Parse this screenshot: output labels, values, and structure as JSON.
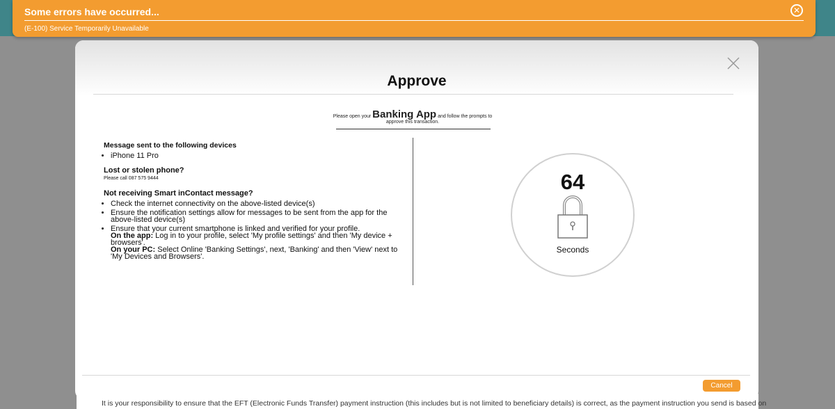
{
  "error_banner": {
    "title": "Some errors have occurred...",
    "message": "(E-100) Service Temporarily Unavailable",
    "close_icon": "circle-x-icon"
  },
  "modal": {
    "title": "Approve",
    "instruction": {
      "prefix": "Please open your",
      "app_name": "Banking App",
      "suffix": "and follow the prompts to approve this transaction."
    },
    "devices": {
      "heading": "Message sent to the following devices",
      "items": [
        "iPhone 11 Pro"
      ]
    },
    "lost_phone": {
      "heading": "Lost or stolen phone?",
      "text": "Please call 087 575 9444"
    },
    "not_receiving": {
      "heading": "Not receiving Smart inContact message?",
      "items": [
        "Check the internet connectivity on the above-listed device(s)",
        "Ensure the notification settings allow for messages to be sent from the app for the above-listed device(s)",
        "Ensure that your current smartphone is linked and verified for your profile."
      ],
      "app_label": "On the app:",
      "app_text": " Log in to your profile, select 'My profile settings' and then 'My device + browsers'.",
      "pc_label": "On your PC:",
      "pc_text": " Select Online 'Banking Settings', next, 'Banking' and then 'View' next to 'My Devices and Browsers'."
    },
    "timer": {
      "value": "64",
      "label": "Seconds",
      "icon": "lock-icon"
    },
    "cancel_label": "Cancel",
    "close_icon": "close-icon"
  },
  "footer_text": "It is your responsibility to ensure that the EFT (Electronic Funds Transfer) payment instruction (this includes but is not limited to beneficiary details) is correct, as the payment instruction you send is based on",
  "colors": {
    "accent": "#f39c30",
    "header_bg": "#3f8589",
    "overlay": "#8f8f8f"
  }
}
